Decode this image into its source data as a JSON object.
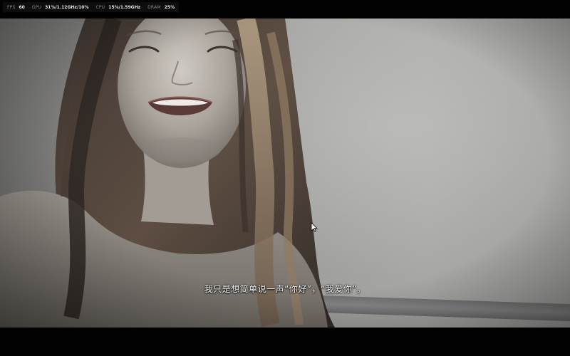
{
  "perf_overlay": {
    "fps": {
      "label": "FPS",
      "value": "60"
    },
    "gpu": {
      "label": "GPU",
      "value": "31%/1.12GHz/10%"
    },
    "cpu": {
      "label": "CPU",
      "value": "15%/1.59GHz"
    },
    "dram": {
      "label": "DRAM",
      "value": "25%"
    }
  },
  "scene": {
    "subtitle": "我只是想简单说一声“你好”，“我爱你”。"
  },
  "cursor": {
    "icon": "arrow-cursor-icon"
  },
  "colors": {
    "background": "#000000",
    "subtitle_text": "#f2f2f2",
    "overlay_bg": "#0d0d0d"
  }
}
